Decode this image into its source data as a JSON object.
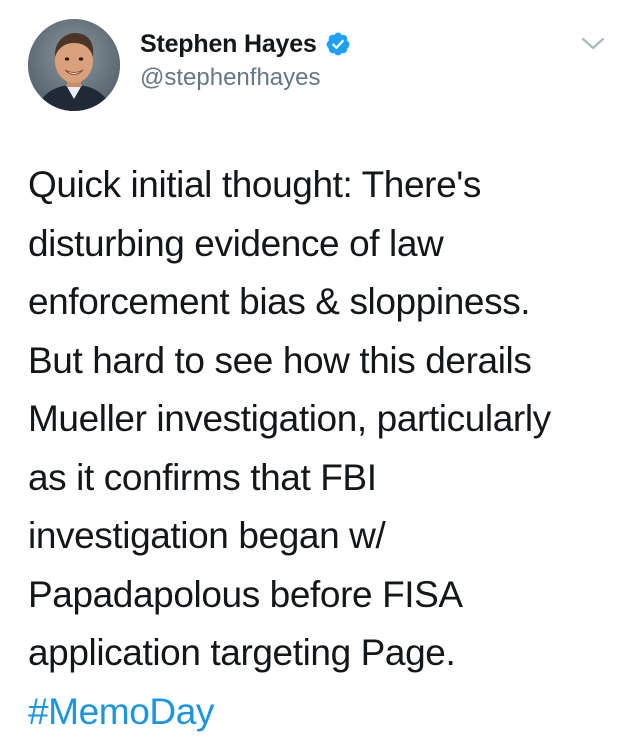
{
  "author": {
    "display_name": "Stephen Hayes",
    "handle": "@stephenfhayes",
    "verified": true,
    "avatar_icon": "profile-photo"
  },
  "tweet": {
    "lines": [
      "Quick initial thought: There's",
      "disturbing evidence of law",
      "enforcement bias & sloppiness.",
      "But hard to see how this derails",
      "Mueller investigation, particularly",
      "as it confirms that FBI",
      "investigation began w/",
      "Papadapolous before FISA",
      "application targeting Page."
    ],
    "hashtag": "#MemoDay"
  },
  "menu": {
    "icon": "chevron-down-icon"
  },
  "colors": {
    "text": "#14171a",
    "handle": "#657786",
    "link": "#1b95e0",
    "verified": "#1da1f2",
    "chevron": "#aab8c2"
  }
}
